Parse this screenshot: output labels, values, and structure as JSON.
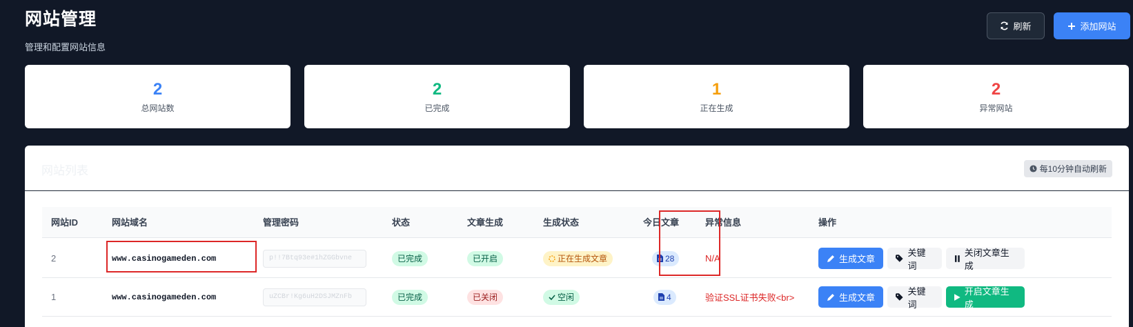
{
  "header": {
    "title": "网站管理",
    "subtitle": "管理和配置网站信息",
    "refresh_label": "刷新",
    "add_label": "添加网站"
  },
  "stats": [
    {
      "value": "2",
      "label": "总网站数",
      "color": "#3b82f6"
    },
    {
      "value": "2",
      "label": "已完成",
      "color": "#10b981"
    },
    {
      "value": "1",
      "label": "正在生成",
      "color": "#f59e0b"
    },
    {
      "value": "2",
      "label": "异常网站",
      "color": "#ef4444"
    }
  ],
  "panel": {
    "title": "网站列表",
    "auto_refresh": "每10分钟自动刷新"
  },
  "table": {
    "headers": [
      "网站ID",
      "网站域名",
      "管理密码",
      "状态",
      "文章生成",
      "生成状态",
      "今日文章",
      "异常信息",
      "操作"
    ],
    "rows": [
      {
        "id": "2",
        "domain": "www.casinogameden.com",
        "password": "p!!7Btq93e#1hZGGbvne",
        "status": "已完成",
        "article_gen": "已开启",
        "gen_status": "正在生成文章",
        "today": "28",
        "error": "N/A",
        "actions": [
          "生成文章",
          "关键词",
          "关闭文章生成"
        ]
      },
      {
        "id": "1",
        "domain": "www.casinogameden.com",
        "password": "uZCBr!Kg6uH2DSJMZnFb",
        "status": "已完成",
        "article_gen": "已关闭",
        "gen_status": "空闲",
        "today": "4",
        "error": "验证SSL证书失败<br>",
        "actions": [
          "生成文章",
          "关键词",
          "开启文章生成"
        ]
      }
    ]
  },
  "icons": {
    "refresh": "sync-icon",
    "add": "plus-icon",
    "clock": "clock-icon",
    "file": "file-icon",
    "edit": "pencil-icon",
    "tag": "tags-icon",
    "pause": "pause-icon",
    "play": "play-icon",
    "spinner": "spinner-icon",
    "check": "check-icon"
  }
}
